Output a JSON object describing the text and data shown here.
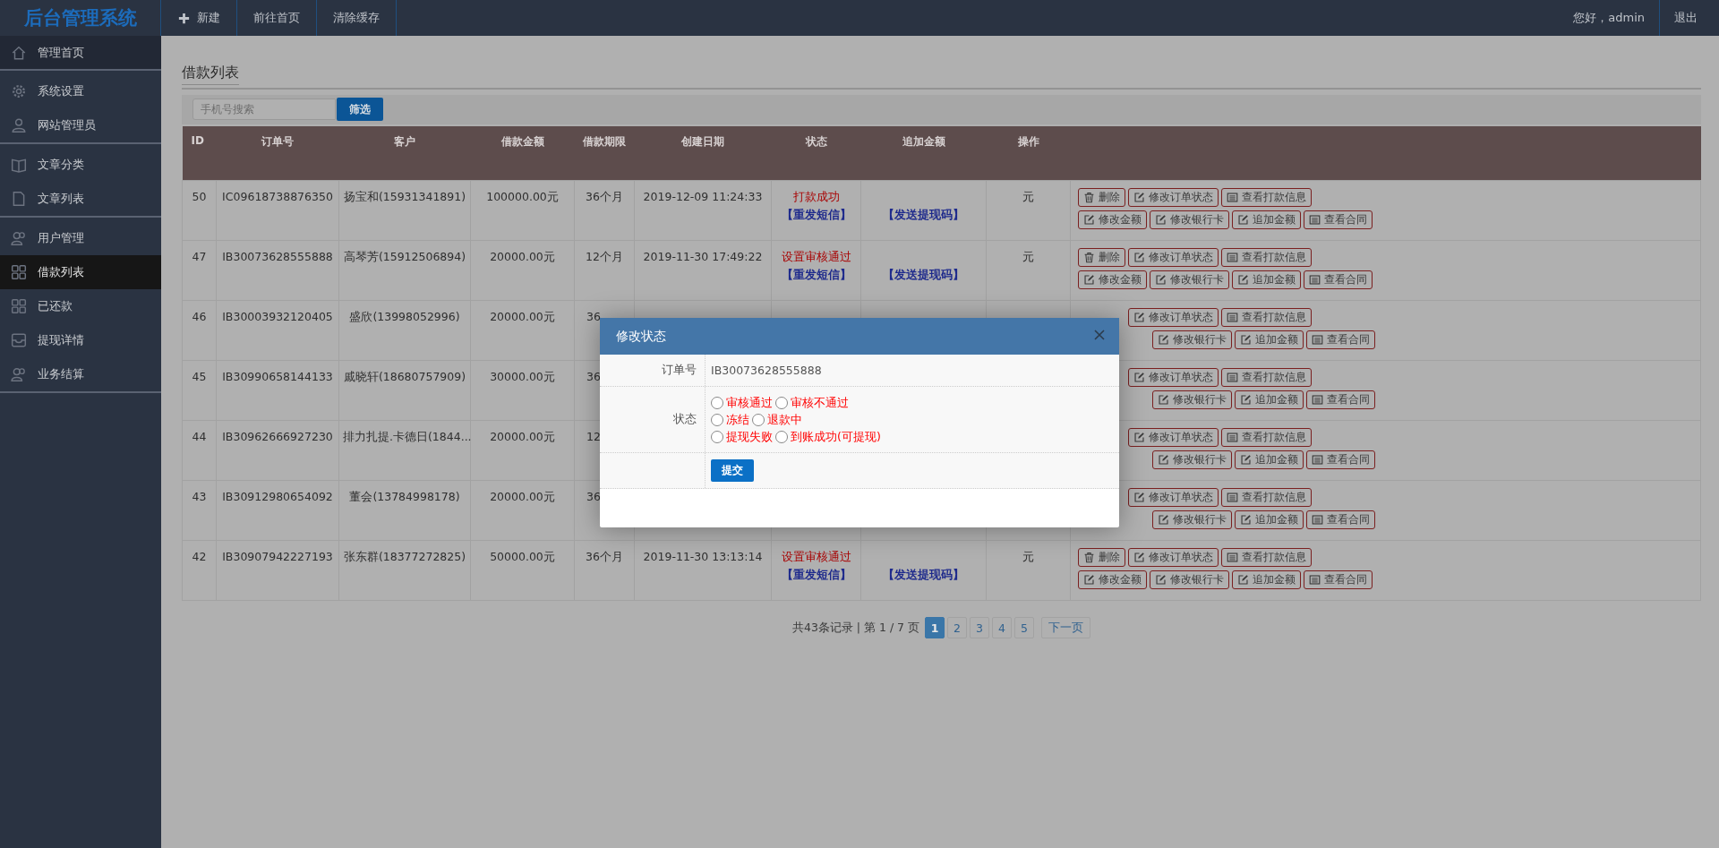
{
  "app": {
    "logo": "后台管理系统"
  },
  "topnav": [
    {
      "label": "新建"
    },
    {
      "label": "前往首页"
    },
    {
      "label": "清除缓存"
    }
  ],
  "user": {
    "greeting": "您好，admin",
    "logout": "退出"
  },
  "sidebar": {
    "groups": [
      {
        "items": [
          {
            "label": "管理首页",
            "kind": "header",
            "selected": false
          }
        ]
      },
      {
        "items": [
          {
            "label": "系统设置",
            "kind": "link",
            "selected": false
          },
          {
            "label": "网站管理员",
            "kind": "link",
            "selected": false
          }
        ]
      },
      {
        "items": [
          {
            "label": "文章分类",
            "kind": "link",
            "selected": false
          },
          {
            "label": "文章列表",
            "kind": "link",
            "selected": false
          }
        ]
      },
      {
        "items": [
          {
            "label": "用户管理",
            "kind": "link",
            "selected": false
          },
          {
            "label": "借款列表",
            "kind": "link",
            "selected": true
          },
          {
            "label": "已还款",
            "kind": "link",
            "selected": false
          },
          {
            "label": "提现详情",
            "kind": "link",
            "selected": false
          },
          {
            "label": "业务结算",
            "kind": "link",
            "selected": false
          }
        ]
      }
    ]
  },
  "page": {
    "title": "借款列表",
    "search": {
      "placeholder": "手机号搜索",
      "button": "筛选"
    },
    "table": {
      "columns": [
        "ID",
        "订单号",
        "客户",
        "借款金额",
        "借款期限",
        "创建日期",
        "状态",
        "追加金额",
        "操作"
      ],
      "rows": [
        {
          "id": "50",
          "order": "IC09618738876350",
          "customer": "扬宝和(15931341891)",
          "amount": "100000.00元",
          "term": "36个月",
          "date": "2019-12-09 11:24:33",
          "status": "打款成功",
          "sms": "【重发短信】",
          "code": "【发送提现码】",
          "extra": "元",
          "actions": [
            [
              "删除",
              "修改订单状态",
              "查看打款信息"
            ],
            [
              "修改金额",
              "修改银行卡",
              "追加金额",
              "查看合同"
            ]
          ]
        },
        {
          "id": "47",
          "order": "IB30073628555888",
          "customer": "高琴芳(15912506894)",
          "amount": "20000.00元",
          "term": "12个月",
          "date": "2019-11-30 17:49:22",
          "status": "设置审核通过",
          "sms": "【重发短信】",
          "code": "【发送提现码】",
          "extra": "元",
          "actions": [
            [
              "删除",
              "修改订单状态",
              "查看打款信息"
            ],
            [
              "修改金额",
              "修改银行卡",
              "追加金额",
              "查看合同"
            ]
          ]
        },
        {
          "id": "46",
          "order": "IB30003932120405",
          "customer": "盛欣(13998052996)",
          "amount": "20000.00元",
          "term": "36",
          "actions": [
            [
              "修改订单状态",
              "查看打款信息"
            ],
            [
              "修改银行卡",
              "追加金额",
              "查看合同"
            ]
          ]
        },
        {
          "id": "45",
          "order": "IB30990658144133",
          "customer": "戚晓轩(18680757909)",
          "amount": "30000.00元",
          "term": "36",
          "actions": [
            [
              "修改订单状态",
              "查看打款信息"
            ],
            [
              "修改银行卡",
              "追加金额",
              "查看合同"
            ]
          ]
        },
        {
          "id": "44",
          "order": "IB30962666927230",
          "customer": "排力扎提.卡德日(1844...",
          "amount": "20000.00元",
          "term": "12",
          "actions": [
            [
              "修改订单状态",
              "查看打款信息"
            ],
            [
              "修改银行卡",
              "追加金额",
              "查看合同"
            ]
          ]
        },
        {
          "id": "43",
          "order": "IB30912980654092",
          "customer": "董会(13784998178)",
          "amount": "20000.00元",
          "term": "36",
          "actions": [
            [
              "修改订单状态",
              "查看打款信息"
            ],
            [
              "修改银行卡",
              "追加金额",
              "查看合同"
            ]
          ]
        },
        {
          "id": "42",
          "order": "IB30907942227193",
          "customer": "张东群(18377272825)",
          "amount": "50000.00元",
          "term": "36个月",
          "date": "2019-11-30 13:13:14",
          "status": "设置审核通过",
          "sms": "【重发短信】",
          "code": "【发送提现码】",
          "extra": "元",
          "actions": [
            [
              "删除",
              "修改订单状态",
              "查看打款信息"
            ],
            [
              "修改金额",
              "修改银行卡",
              "追加金额",
              "查看合同"
            ]
          ]
        }
      ]
    },
    "pagination": {
      "summary": "共43条记录 | 第 1 / 7 页",
      "pages": [
        {
          "label": "1",
          "selected": true
        },
        {
          "label": "2",
          "selected": false
        },
        {
          "label": "3",
          "selected": false
        },
        {
          "label": "4",
          "selected": false
        },
        {
          "label": "5",
          "selected": false
        }
      ],
      "next": "下一页"
    }
  },
  "modal": {
    "title": "修改状态",
    "fields": [
      {
        "label": "订单号",
        "value": "IB30073628555888"
      }
    ],
    "status_label": "状态",
    "options": [
      [
        {
          "label": "审核通过",
          "selected": false
        },
        {
          "label": "审核不通过",
          "selected": false
        }
      ],
      [
        {
          "label": "冻结",
          "selected": false
        },
        {
          "label": "退款中",
          "selected": false
        }
      ],
      [
        {
          "label": "提现失败",
          "selected": false
        },
        {
          "label": "到账成功(可提现)",
          "selected": false
        }
      ]
    ],
    "submit": "提交"
  }
}
